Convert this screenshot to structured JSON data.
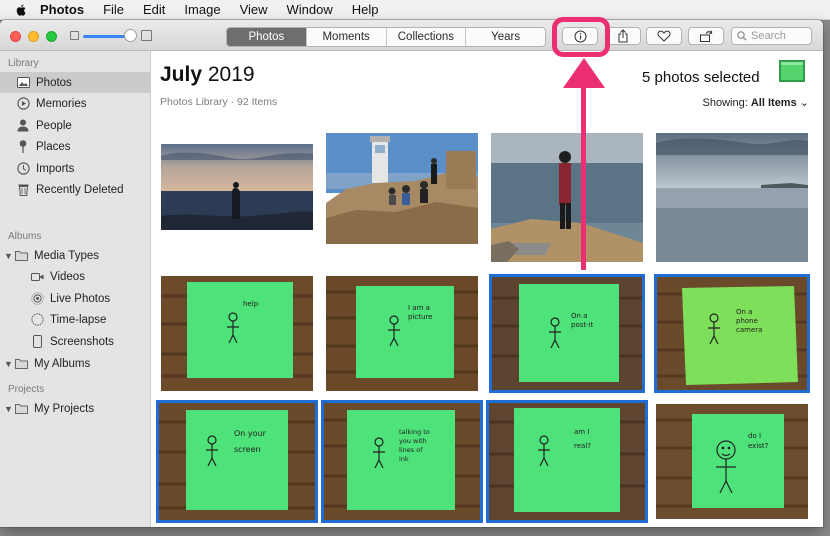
{
  "menubar": {
    "app_name": "Photos",
    "items": [
      "File",
      "Edit",
      "Image",
      "View",
      "Window",
      "Help"
    ]
  },
  "toolbar": {
    "tabs": [
      {
        "label": "Photos",
        "active": true
      },
      {
        "label": "Moments",
        "active": false
      },
      {
        "label": "Collections",
        "active": false
      },
      {
        "label": "Years",
        "active": false
      }
    ],
    "buttons": [
      "info-icon",
      "share-icon",
      "heart-icon",
      "rotate-icon"
    ],
    "search_placeholder": "Search"
  },
  "sidebar": {
    "sections": [
      {
        "label": "Library"
      },
      {
        "label": "Albums"
      },
      {
        "label": "Projects"
      }
    ],
    "items": [
      {
        "label": "Photos",
        "icon": "photos-icon",
        "selected": true
      },
      {
        "label": "Memories",
        "icon": "memories-icon"
      },
      {
        "label": "People",
        "icon": "person-icon"
      },
      {
        "label": "Places",
        "icon": "pin-icon"
      },
      {
        "label": "Imports",
        "icon": "clock-icon"
      },
      {
        "label": "Recently Deleted",
        "icon": "trash-icon"
      },
      {
        "label": "Media Types",
        "icon": "folder-icon"
      },
      {
        "label": "Videos",
        "icon": "video-icon"
      },
      {
        "label": "Live Photos",
        "icon": "live-photo-icon"
      },
      {
        "label": "Time-lapse",
        "icon": "timelapse-icon"
      },
      {
        "label": "Screenshots",
        "icon": "screenshot-icon"
      },
      {
        "label": "My Albums",
        "icon": "folder-icon"
      },
      {
        "label": "My Projects",
        "icon": "folder-icon"
      }
    ]
  },
  "main": {
    "title_month": "July",
    "title_year": "2019",
    "subtitle": "Photos Library · 92 Items",
    "selected_count": "5 photos selected",
    "showing_label": "Showing:",
    "showing_value": "All Items"
  },
  "notes": [
    {
      "lines": [
        "help"
      ]
    },
    {
      "lines": [
        "I am a",
        "picture"
      ]
    },
    {
      "lines": [
        "On a",
        "post-it"
      ]
    },
    {
      "lines": [
        "On a",
        "phone",
        "camera"
      ]
    },
    {
      "lines": [
        "On your",
        "screen"
      ]
    },
    {
      "lines": [
        "talking to",
        "you with",
        "lines of",
        "ink"
      ]
    },
    {
      "lines": [
        "am I",
        "real?"
      ]
    },
    {
      "lines": [
        "do I",
        "exist?"
      ]
    }
  ],
  "colors": {
    "accent": "#1f6ed6",
    "highlight": "#ec2e73",
    "note_green": "#4ee27a"
  }
}
